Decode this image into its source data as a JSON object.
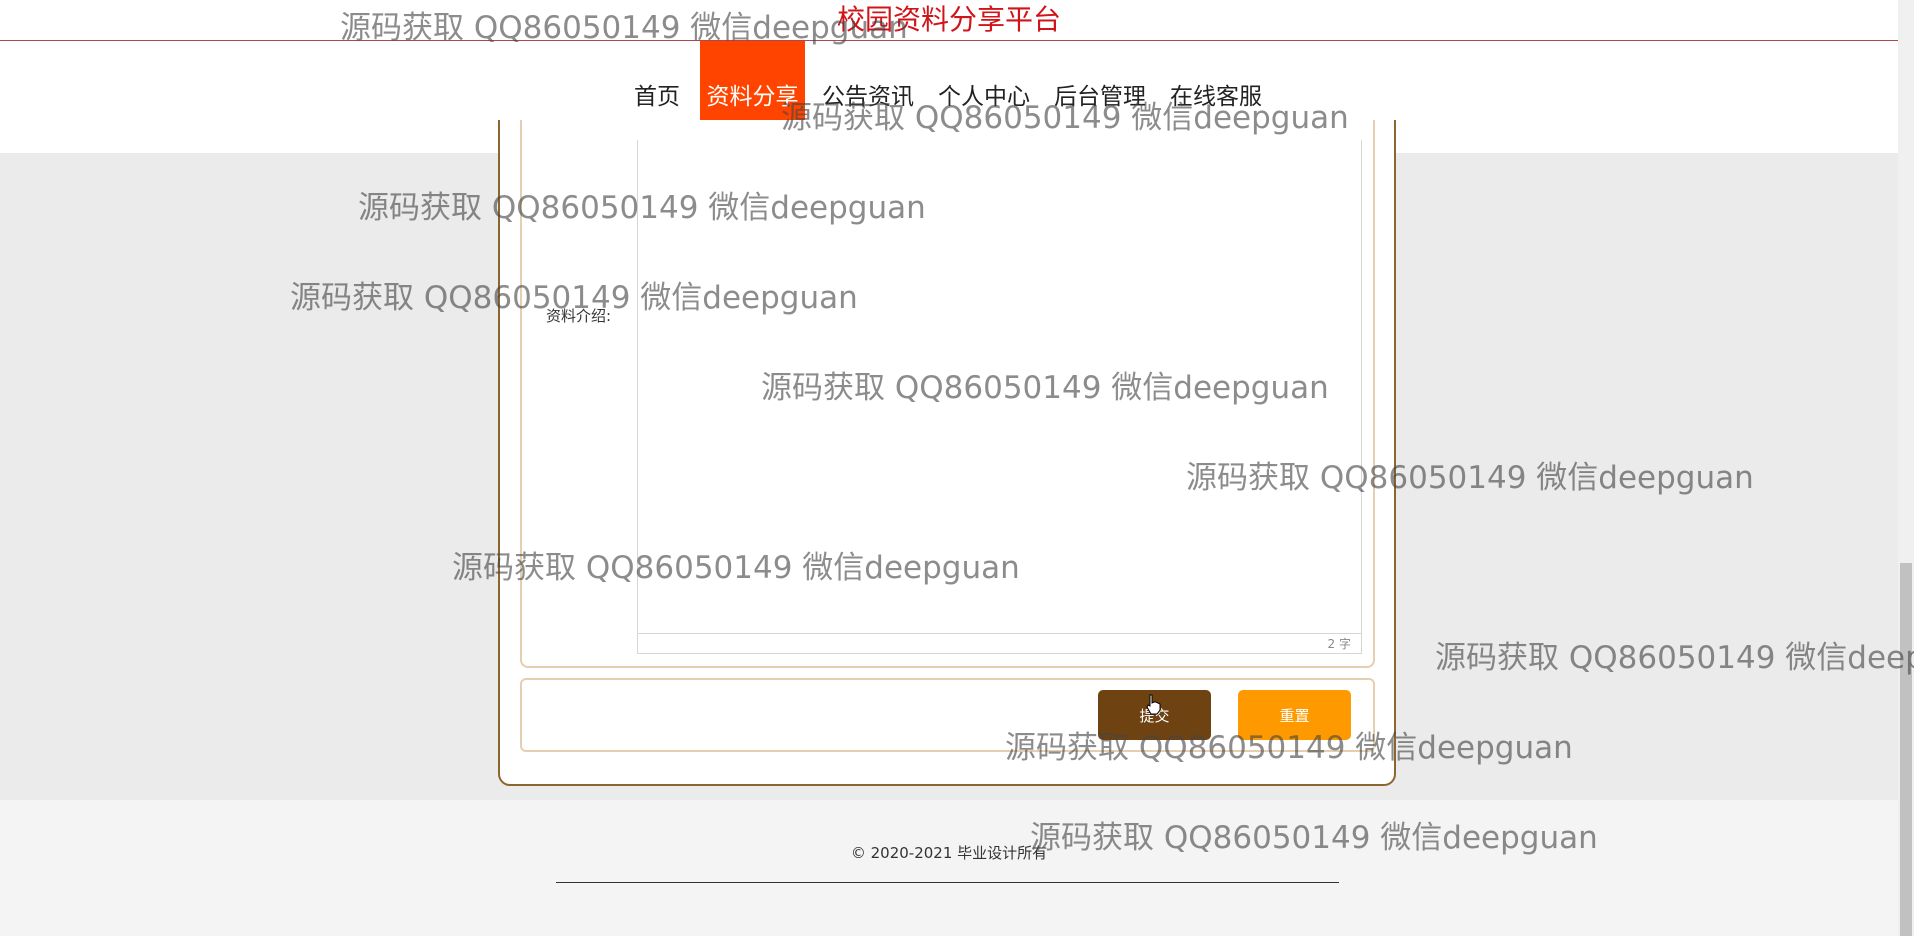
{
  "site": {
    "title": "校园资料分享平台"
  },
  "nav": {
    "items": [
      {
        "label": "首页"
      },
      {
        "label": "资料分享"
      },
      {
        "label": "公告资讯"
      },
      {
        "label": "个人中心"
      },
      {
        "label": "后台管理"
      },
      {
        "label": "在线客服"
      }
    ],
    "active_index": 1
  },
  "form": {
    "intro_label": "资料介绍:",
    "editor_word_count": "2 字"
  },
  "buttons": {
    "submit": "提交",
    "reset": "重置"
  },
  "footer": {
    "copyright": "© 2020-2021 毕业设计所有"
  },
  "watermark": {
    "text": "源码获取 QQ86050149 微信deepguan"
  },
  "colors": {
    "brand_red": "#d0141a",
    "nav_active": "#ff4400",
    "submit_brown": "#6f4311",
    "reset_orange": "#ff9900"
  }
}
